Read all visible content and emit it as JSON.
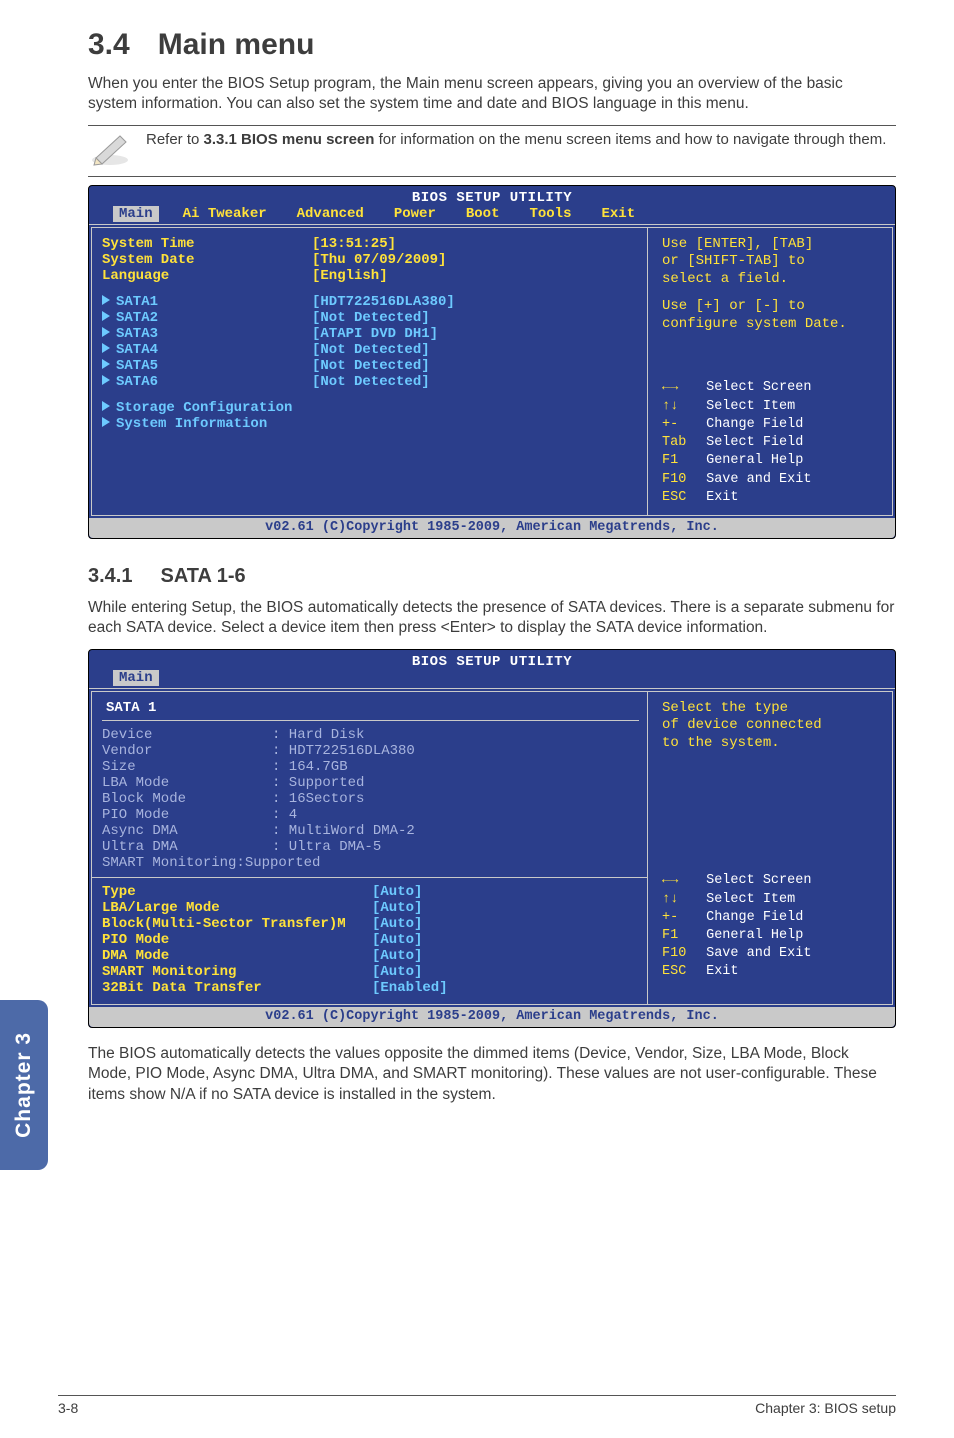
{
  "section": {
    "number": "3.4",
    "title": "Main menu"
  },
  "intro": "When you enter the BIOS Setup program, the Main menu screen appears, giving you an overview of the basic system information. You can also set the system time and date and BIOS language in this menu.",
  "note": {
    "pre": "Refer to ",
    "bold": "3.3.1 BIOS menu screen",
    "post": " for information on the menu screen items and how to navigate through them."
  },
  "bios1": {
    "header": "BIOS SETUP UTILITY",
    "tabs": [
      "Main",
      "Ai Tweaker",
      "Advanced",
      "Power",
      "Boot",
      "Tools",
      "Exit"
    ],
    "active_tab": "Main",
    "fields": {
      "time_label": "System Time",
      "time_value": "[13:51:25]",
      "date_label": "System Date",
      "date_value": "[Thu 07/09/2009]",
      "lang_label": "Language",
      "lang_value": "[English]",
      "sata1_label": "SATA1",
      "sata1_value": "[HDT722516DLA380]",
      "sata2_label": "SATA2",
      "sata2_value": "[Not Detected]",
      "sata3_label": "SATA3",
      "sata3_value": "[ATAPI DVD DH1]",
      "sata4_label": "SATA4",
      "sata4_value": "[Not Detected]",
      "sata5_label": "SATA5",
      "sata5_value": "[Not Detected]",
      "sata6_label": "SATA6",
      "sata6_value": "[Not Detected]",
      "storage": "Storage Configuration",
      "sysinfo": "System Information"
    },
    "help": {
      "l1": "Use [ENTER], [TAB]",
      "l2": "or [SHIFT-TAB] to",
      "l3": "select a field.",
      "l4": "Use [+] or [-] to",
      "l5": "configure system Date."
    },
    "keys": {
      "k1": "←→",
      "t1": "Select Screen",
      "k2": "↑↓",
      "t2": "Select Item",
      "k3": "+-",
      "t3": "Change Field",
      "k4": "Tab",
      "t4": "Select Field",
      "k5": "F1",
      "t5": "General Help",
      "k6": "F10",
      "t6": "Save and Exit",
      "k7": "ESC",
      "t7": "Exit"
    },
    "footer": "v02.61 (C)Copyright 1985-2009, American Megatrends, Inc."
  },
  "sub": {
    "number": "3.4.1",
    "title": "SATA 1-6"
  },
  "sub_intro": "While entering Setup, the BIOS automatically detects the presence of SATA devices. There is a separate submenu for each SATA device. Select a device item then press <Enter> to display the SATA device information.",
  "bios2": {
    "header": "BIOS SETUP UTILITY",
    "tab": "Main",
    "sata_header": "SATA 1",
    "info": {
      "device_l": "Device",
      "device_v": ": Hard Disk",
      "vendor_l": "Vendor",
      "vendor_v": ": HDT722516DLA380",
      "size_l": "Size",
      "size_v": ": 164.7GB",
      "lba_l": "LBA Mode",
      "lba_v": ": Supported",
      "block_l": "Block Mode",
      "block_v": ": 16Sectors",
      "pio_l": "PIO Mode",
      "pio_v": ": 4",
      "async_l": "Async DMA",
      "async_v": ": MultiWord DMA-2",
      "ultra_l": "Ultra DMA",
      "ultra_v": ": Ultra DMA-5",
      "smart": "SMART Monitoring:Supported"
    },
    "opts": {
      "type_l": "Type",
      "type_v": "[Auto]",
      "lba_l": "LBA/Large Mode",
      "lba_v": "[Auto]",
      "block_l": "Block(Multi-Sector Transfer)M",
      "block_v": "[Auto]",
      "pio_l": "PIO Mode",
      "pio_v": "[Auto]",
      "dma_l": "DMA Mode",
      "dma_v": "[Auto]",
      "smart_l": "SMART Monitoring",
      "smart_v": "[Auto]",
      "bit_l": "32Bit Data Transfer",
      "bit_v": "[Enabled]"
    },
    "help": {
      "l1": "Select the type",
      "l2": "of device connected",
      "l3": "to the system."
    },
    "keys": {
      "k1": "←→",
      "t1": "Select Screen",
      "k2": "↑↓",
      "t2": "Select Item",
      "k3": "+-",
      "t3": "Change Field",
      "k4": "F1",
      "t4": "General Help",
      "k5": "F10",
      "t5": "Save and Exit",
      "k6": "ESC",
      "t6": "Exit"
    },
    "footer": "v02.61 (C)Copyright 1985-2009, American Megatrends, Inc."
  },
  "outro": "The BIOS automatically detects the values opposite the dimmed items (Device, Vendor, Size, LBA Mode, Block Mode, PIO Mode, Async DMA, Ultra DMA, and SMART monitoring). These values are not user-configurable. These items show N/A if no SATA device is installed in the system.",
  "sidetab": "Chapter 3",
  "footer_left": "3-8",
  "footer_right": "Chapter 3: BIOS setup"
}
